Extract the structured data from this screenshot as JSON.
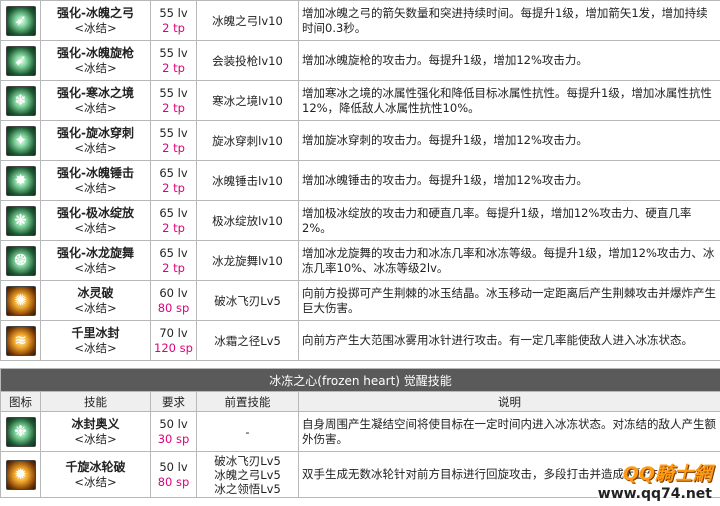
{
  "skills": [
    {
      "name": "强化-冰魄之弓",
      "tag": "<冰结>",
      "lv": "55 lv",
      "pts": "2 tp",
      "prereq": "冰魄之弓lv10",
      "desc": "增加冰魄之弓的箭矢数量和突进持续时间。每提升1级，增加箭矢1发，增加持续时间0.3秒。",
      "icon": "ice-bow-icon"
    },
    {
      "name": "强化-冰魄旋枪",
      "tag": "<冰结>",
      "lv": "55 lv",
      "pts": "2 tp",
      "prereq": "会装投枪lv10",
      "desc": "增加冰魄旋枪的攻击力。每提升1级，增加12%攻击力。",
      "icon": "ice-spear-icon"
    },
    {
      "name": "强化-寒冰之境",
      "tag": "<冰结>",
      "lv": "55 lv",
      "pts": "2 tp",
      "prereq": "寒冰之境lv10",
      "desc": "增加寒冰之境的冰属性强化和降低目标冰属性抗性。每提升1级，增加冰属性抗性12%，降低敌人冰属性抗性10%。",
      "icon": "ice-realm-icon"
    },
    {
      "name": "强化-旋冰穿刺",
      "tag": "<冰结>",
      "lv": "55 lv",
      "pts": "2 tp",
      "prereq": "旋冰穿刺lv10",
      "desc": "增加旋冰穿刺的攻击力。每提升1级，增加12%攻击力。",
      "icon": "ice-pierce-icon"
    },
    {
      "name": "强化-冰魄锤击",
      "tag": "<冰结>",
      "lv": "65 lv",
      "pts": "2 tp",
      "prereq": "冰魄锤击lv10",
      "desc": "增加冰魄锤击的攻击力。每提升1级，增加12%攻击力。",
      "icon": "ice-hammer-icon"
    },
    {
      "name": "强化-极冰绽放",
      "tag": "<冰结>",
      "lv": "65 lv",
      "pts": "2 tp",
      "prereq": "极冰绽放lv10",
      "desc": "增加极冰绽放的攻击力和硬直几率。每提升1级，增加12%攻击力、硬直几率2%。",
      "icon": "ice-bloom-icon"
    },
    {
      "name": "强化-冰龙旋舞",
      "tag": "<冰结>",
      "lv": "65 lv",
      "pts": "2 tp",
      "prereq": "冰龙旋舞lv10",
      "desc": "增加冰龙旋舞的攻击力和冰冻几率和冰冻等级。每提升1级，增加12%攻击力、冰冻几率10%、冰冻等级2lv。",
      "icon": "ice-dragon-icon"
    },
    {
      "name": "冰灵破",
      "tag": "<冰结>",
      "lv": "60 lv",
      "pts": "80 sp",
      "prereq": "破冰飞刃Lv5",
      "desc": "向前方投掷可产生荆棘的冰玉结晶。冰玉移动一定距离后产生荆棘攻击并爆炸产生巨大伤害。",
      "icon": "ice-crystal-icon"
    },
    {
      "name": "千里冰封",
      "tag": "<冰结>",
      "lv": "70 lv",
      "pts": "120 sp",
      "prereq": "冰霜之径Lv5",
      "desc": "向前方产生大范围冰雾用冰针进行攻击。有一定几率能使敌人进入冰冻状态。",
      "icon": "ice-seal-icon"
    }
  ],
  "awaken": {
    "title": "冰冻之心(frozen heart) 觉醒技能",
    "headers": {
      "icon": "图标",
      "skill": "技能",
      "req": "要求",
      "prereq": "前置技能",
      "desc": "说明"
    },
    "rows": [
      {
        "name": "冰封奥义",
        "tag": "<冰结>",
        "lv": "50 lv",
        "pts": "30 sp",
        "prereq": "-",
        "desc": "自身周围产生凝结空间将使目标在一定时间内进入冰冻状态。对冻结的敌人产生额外伤害。",
        "icon": "frost-mystery-icon"
      },
      {
        "name": "千旋冰轮破",
        "tag": "<冰结>",
        "lv": "50 lv",
        "pts": "80 sp",
        "prereq": "破冰飞刃Lv5\n冰魄之弓Lv5\n冰之领悟Lv5",
        "prereq_lines": [
          "破冰飞刃Lv5",
          "冰魄之弓Lv5",
          "冰之领悟Lv5"
        ],
        "desc": "双手生成无数冰轮针对前方目标进行回旋攻击，多段打击并造成大量伤害。",
        "icon": "frost-wheel-icon"
      }
    ]
  },
  "watermark": {
    "brand": "QQ騎士網",
    "url": "www.qq74.net"
  },
  "colors": {
    "points": "#e0007a",
    "section_bar": "#5a5a5a",
    "header_bg": "#efefef",
    "icon_green": "#1e5a34",
    "icon_orange": "#f0a52a",
    "watermark": "#ff9a12"
  }
}
